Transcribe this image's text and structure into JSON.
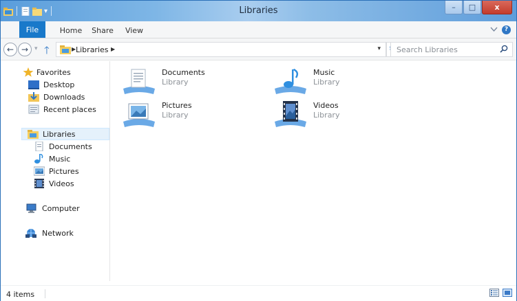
{
  "window": {
    "title": "Libraries",
    "buttons": [
      "minimize",
      "maximize",
      "close"
    ],
    "close_label": "x",
    "minimize_label": "–",
    "maximize_label": "□"
  },
  "ribbon": {
    "tabs": [
      "File",
      "Home",
      "Share",
      "View"
    ],
    "expand_icon": "chevron-down-icon",
    "help_icon": "help-icon"
  },
  "nav": {
    "breadcrumb": [
      "Libraries"
    ],
    "search_placeholder": "Search Libraries"
  },
  "sidebar": {
    "favorites": {
      "label": "Favorites",
      "items": [
        "Desktop",
        "Downloads",
        "Recent places"
      ]
    },
    "libraries": {
      "label": "Libraries",
      "items": [
        "Documents",
        "Music",
        "Pictures",
        "Videos"
      ]
    },
    "computer": "Computer",
    "network": "Network"
  },
  "libraries": [
    {
      "name": "Documents",
      "type": "Library",
      "icon": "documents-library-icon"
    },
    {
      "name": "Music",
      "type": "Library",
      "icon": "music-library-icon"
    },
    {
      "name": "Pictures",
      "type": "Library",
      "icon": "pictures-library-icon"
    },
    {
      "name": "Videos",
      "type": "Library",
      "icon": "videos-library-icon"
    }
  ],
  "status": {
    "item_count": "4 items"
  },
  "colors": {
    "accent": "#1979ca",
    "selection": "#e5f1fb"
  }
}
